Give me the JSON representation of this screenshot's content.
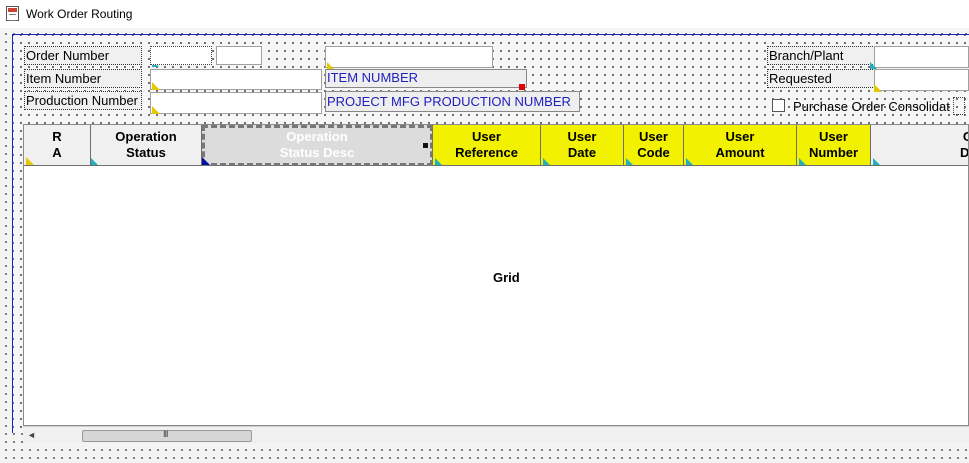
{
  "window": {
    "title": "Work Order Routing",
    "icon": "doc-icon"
  },
  "header_fields": {
    "order_number_label": "Order Number",
    "item_number_label": "Item Number",
    "production_number_label": "Production Number",
    "item_number_caption": "ITEM NUMBER",
    "project_caption": "PROJECT MFG PRODUCTION NUMBER",
    "branch_plant_label": "Branch/Plant",
    "requested_label": "Requested",
    "purchase_order_label": "Purchase Order Consolidat",
    "purchase_order_checked": false
  },
  "grid": {
    "label": "Grid",
    "columns": [
      {
        "line1": "R",
        "line2": "A",
        "highlight": false
      },
      {
        "line1": "Operation",
        "line2": "Status",
        "highlight": false
      },
      {
        "line1": "Operation",
        "line2": "Status Desc",
        "highlight": false
      },
      {
        "line1": "User",
        "line2": "Reference",
        "highlight": true
      },
      {
        "line1": "User",
        "line2": "Date",
        "highlight": true
      },
      {
        "line1": "User",
        "line2": "Code",
        "highlight": true
      },
      {
        "line1": "User",
        "line2": "Amount",
        "highlight": true
      },
      {
        "line1": "User",
        "line2": "Number",
        "highlight": true
      },
      {
        "line1": "Op",
        "line2": "Des",
        "highlight": false
      }
    ]
  },
  "colors": {
    "highlight_yellow": "#f2f200",
    "caption_blue": "#2020c0",
    "frame_blue": "#2020c0"
  },
  "scrollbar": {
    "left_arrow": "◄",
    "grip": "III"
  }
}
